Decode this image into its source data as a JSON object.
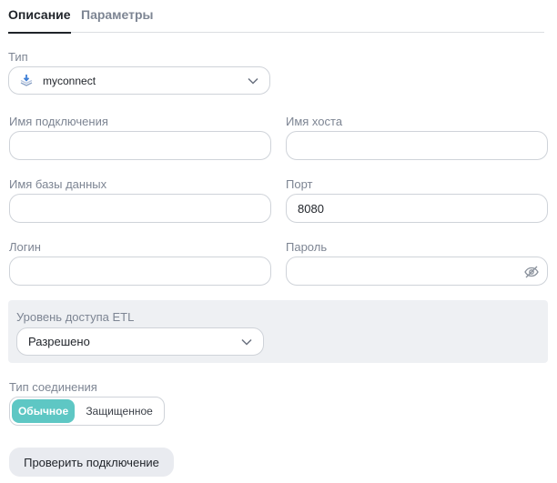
{
  "tabs": [
    {
      "label": "Описание",
      "active": true
    },
    {
      "label": "Параметры",
      "active": false
    }
  ],
  "type_field": {
    "label": "Тип",
    "value": "myconnect",
    "icon": "download-stack-icon"
  },
  "connection_name": {
    "label": "Имя подключения",
    "value": ""
  },
  "host_name": {
    "label": "Имя хоста",
    "value": ""
  },
  "database_name": {
    "label": "Имя базы данных",
    "value": ""
  },
  "port": {
    "label": "Порт",
    "value": "8080"
  },
  "login": {
    "label": "Логин",
    "value": ""
  },
  "password": {
    "label": "Пароль",
    "value": "",
    "icon": "eye-off-icon"
  },
  "etl_access": {
    "label": "Уровень доступа ETL",
    "value": "Разрешено"
  },
  "connection_type": {
    "label": "Тип соединения",
    "options": [
      "Обычное",
      "Защищенное"
    ],
    "selected": "Обычное"
  },
  "check_button": {
    "label": "Проверить подключение"
  },
  "colors": {
    "accent": "#5ec7c4",
    "etl_bg": "#eef0f3",
    "border": "#cfd3d9"
  }
}
